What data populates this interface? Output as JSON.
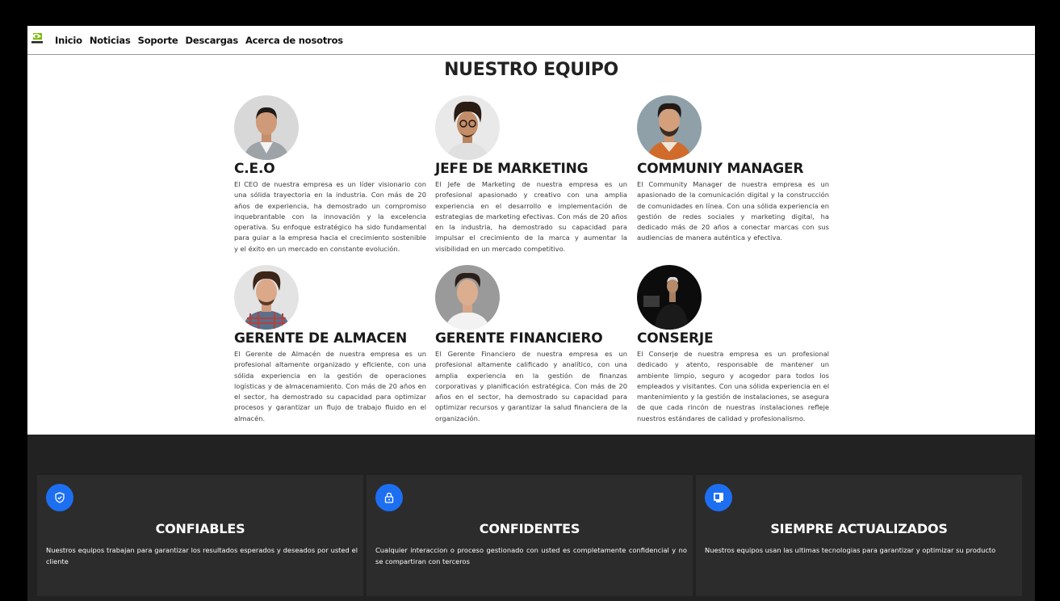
{
  "nav": {
    "logo_icon": "nvidia-logo-icon",
    "links": [
      "Inicio",
      "Noticias",
      "Soporte",
      "Descargas",
      "Acerca de nosotros"
    ]
  },
  "team": {
    "title": "NUESTRO EQUIPO",
    "members": [
      {
        "title": "C.E.O",
        "desc": "El CEO de nuestra empresa es un líder visionario con una sólida trayectoria en la industria. Con más de 20 años de experiencia, ha demostrado un compromiso inquebrantable con la innovación y la excelencia operativa. Su enfoque estratégico ha sido fundamental para guiar a la empresa hacia el crecimiento sostenible y el éxito en un mercado en constante evolución."
      },
      {
        "title": "JEFE DE MARKETING",
        "desc": "El Jefe de Marketing de nuestra empresa es un profesional apasionado y creativo con una amplia experiencia en el desarrollo e implementación de estrategias de marketing efectivas. Con más de 20 años en la industria, ha demostrado su capacidad para impulsar el crecimiento de la marca y aumentar la visibilidad en un mercado competitivo."
      },
      {
        "title": "COMMUNIY MANAGER",
        "desc": "El Community Manager de nuestra empresa es un apasionado de la comunicación digital y la construcción de comunidades en línea. Con una sólida experiencia en gestión de redes sociales y marketing digital, ha dedicado más de 20 años a conectar marcas con sus audiencias de manera auténtica y efectiva."
      },
      {
        "title": "GERENTE DE ALMACEN",
        "desc": "El Gerente de Almacén de nuestra empresa es un profesional altamente organizado y eficiente, con una sólida experiencia en la gestión de operaciones logísticas y de almacenamiento. Con más de 20 años en el sector, ha demostrado su capacidad para optimizar procesos y garantizar un flujo de trabajo fluido en el almacén."
      },
      {
        "title": "GERENTE FINANCIERO",
        "desc": "El Gerente Financiero de nuestra empresa es un profesional altamente calificado y analítico, con una amplia experiencia en la gestión de finanzas corporativas y planificación estratégica. Con más de 20 años en el sector, ha demostrado su capacidad para optimizar recursos y garantizar la salud financiera de la organización."
      },
      {
        "title": "CONSERJE",
        "desc": "El Conserje de nuestra empresa es un profesional dedicado y atento, responsable de mantener un ambiente limpio, seguro y acogedor para todos los empleados y visitantes. Con una sólida experiencia en el mantenimiento y la gestión de instalaciones, se asegura de que cada rincón de nuestras instalaciones refleje nuestros estándares de calidad y profesionalismo."
      }
    ]
  },
  "features": {
    "accent": "#1d6ff2",
    "cards": [
      {
        "icon": "shield-check-icon",
        "title": "CONFIABLES",
        "text": "Nuestros equipos trabajan para garantizar los resultados esperados y deseados por usted el cliente"
      },
      {
        "icon": "lock-icon",
        "title": "CONFIDENTES",
        "text": "Cualquier interaccion o proceso gestionado con usted es completamente confidencial y no se compartiran con terceros"
      },
      {
        "icon": "monitor-icon",
        "title": "SIEMPRE ACTUALIZADOS",
        "text": "Nuestros equipos usan las ultimas tecnologias para garantizar y optimizar su producto"
      }
    ]
  }
}
